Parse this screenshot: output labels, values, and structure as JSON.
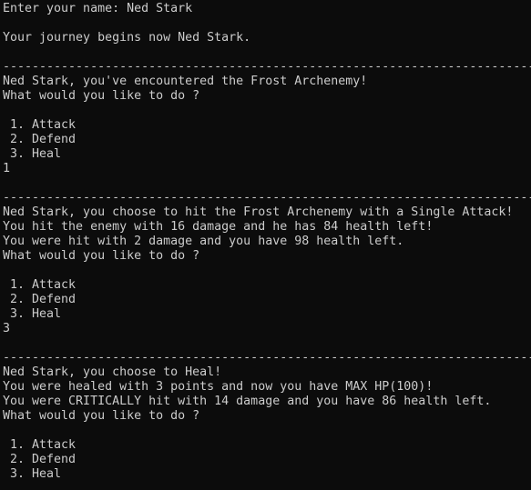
{
  "console": {
    "lines": [
      "Enter your name: Ned Stark",
      "",
      "Your journey begins now Ned Stark.",
      "",
      "----------------------------------------------------------------------------------------------------",
      "Ned Stark, you've encountered the Frost Archenemy!",
      "What would you like to do ?",
      "",
      " 1. Attack",
      " 2. Defend",
      " 3. Heal",
      "1",
      "",
      "----------------------------------------------------------------------------------------------------",
      "Ned Stark, you choose to hit the Frost Archenemy with a Single Attack!",
      "You hit the enemy with 16 damage and he has 84 health left!",
      "You were hit with 2 damage and you have 98 health left.",
      "What would you like to do ?",
      "",
      " 1. Attack",
      " 2. Defend",
      " 3. Heal",
      "3",
      "",
      "----------------------------------------------------------------------------------------------------",
      "Ned Stark, you choose to Heal!",
      "You were healed with 3 points and now you have MAX HP(100)!",
      "You were CRITICALLY hit with 14 damage and you have 86 health left.",
      "What would you like to do ?",
      "",
      " 1. Attack",
      " 2. Defend",
      " 3. Heal"
    ]
  }
}
